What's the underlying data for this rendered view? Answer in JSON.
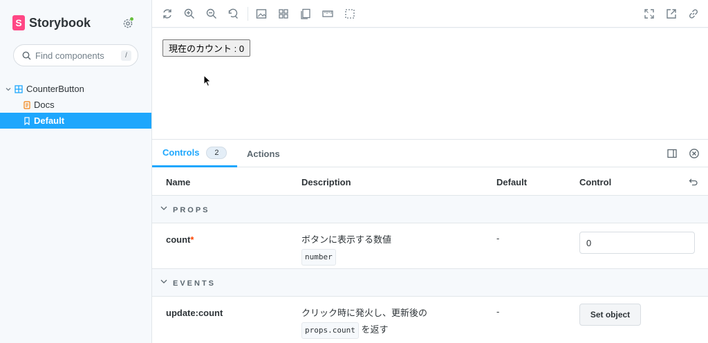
{
  "sidebar": {
    "brand_logo": "S",
    "brand_name": "Storybook",
    "search": {
      "placeholder": "Find components",
      "shortcut": "/"
    },
    "tree": {
      "group": "CounterButton",
      "children": [
        {
          "label": "Docs"
        },
        {
          "label": "Default",
          "selected": true
        }
      ]
    }
  },
  "toolbar": {
    "left_icons": [
      "reload-icon",
      "zoom-in-icon",
      "zoom-out-icon",
      "zoom-reset-icon",
      "background-icon",
      "grid-icon",
      "viewport-icon",
      "measure-icon",
      "outline-icon"
    ],
    "right_icons": [
      "fullscreen-icon",
      "open-new-tab-icon",
      "copy-link-icon"
    ]
  },
  "canvas": {
    "button_label": "現在のカウント : 0"
  },
  "panel": {
    "tabs": [
      {
        "label": "Controls",
        "badge": "2",
        "active": true
      },
      {
        "label": "Actions"
      }
    ],
    "columns": {
      "name": "Name",
      "description": "Description",
      "default": "Default",
      "control": "Control"
    },
    "sections": [
      {
        "label": "PROPS",
        "rows": [
          {
            "name": "count",
            "required": "*",
            "description": "ボタンに表示する数値",
            "type": "number",
            "default": "-",
            "control_value": "0"
          }
        ]
      },
      {
        "label": "EVENTS",
        "rows": [
          {
            "name": "update:count",
            "description_line1": "クリック時に発火し、更新後の",
            "code": "props.count",
            "description_suffix": "を返す",
            "default": "-",
            "control_button": "Set object"
          }
        ]
      }
    ]
  },
  "colors": {
    "accent": "#1ea7fd",
    "brand": "#ff4785",
    "status": "#66bf3c",
    "required": "#ff4400"
  }
}
